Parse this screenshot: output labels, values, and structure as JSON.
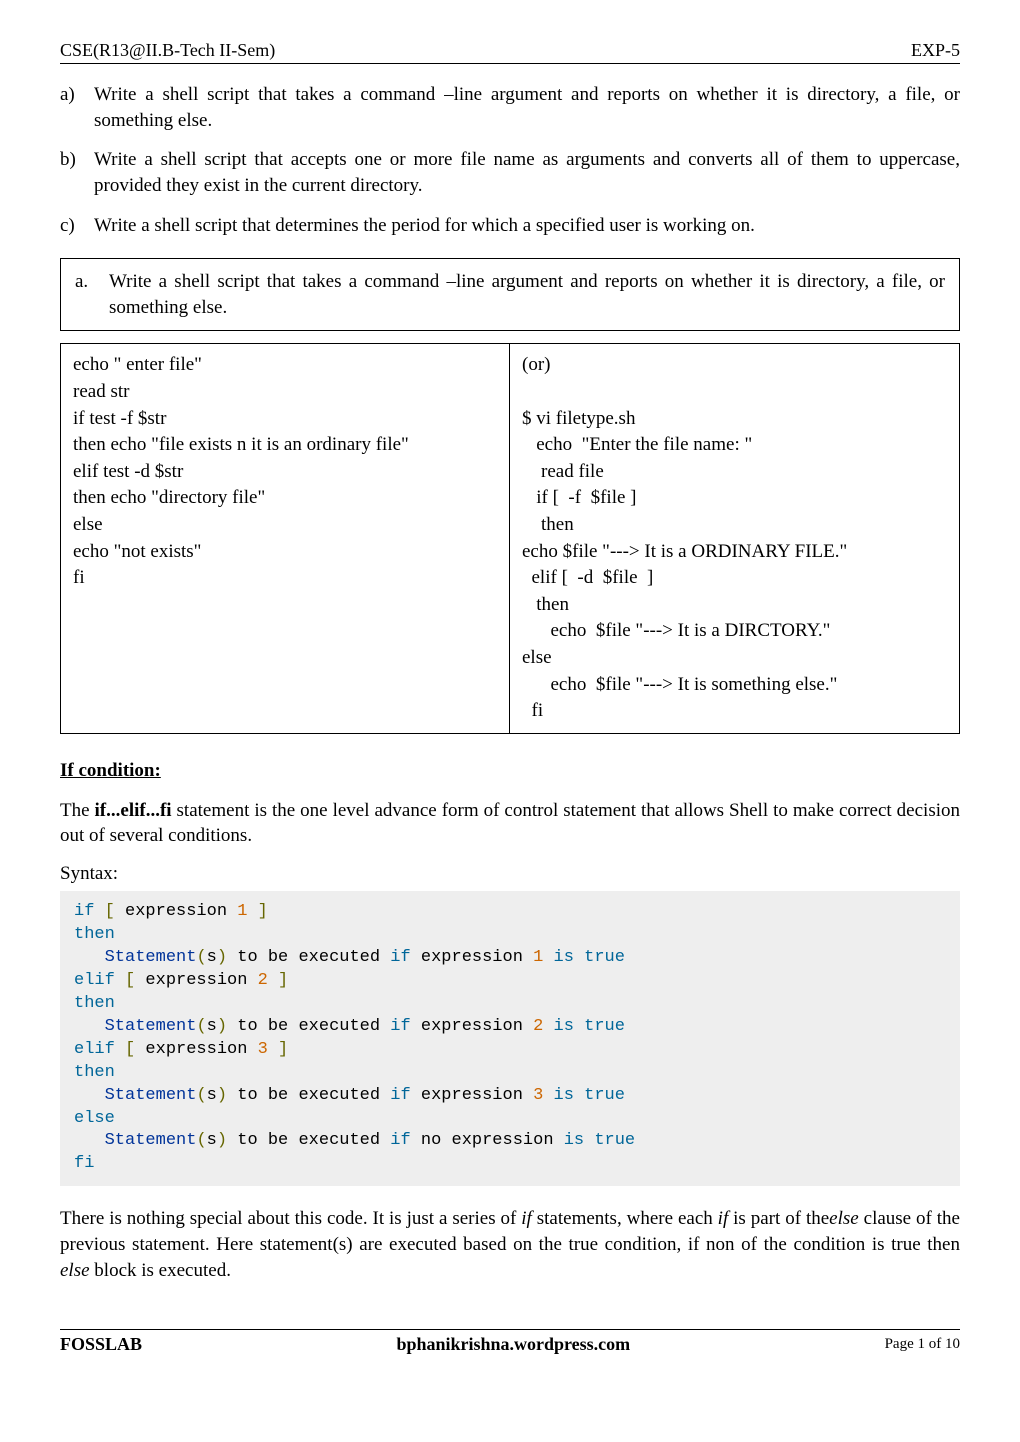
{
  "header": {
    "left": "CSE(R13@II.B-Tech II-Sem)",
    "right": "EXP-5"
  },
  "questions": [
    {
      "letter": "a)",
      "text": "Write a shell script that takes a command –line argument and reports on whether it is directory, a file, or something else."
    },
    {
      "letter": "b)",
      "text": "Write a shell script that accepts one or more file name as arguments and converts all of them to uppercase, provided   they exist in the current directory."
    },
    {
      "letter": "c)",
      "text": "Write a shell script that determines the period for which a specified user is working on."
    }
  ],
  "box_question": {
    "letter": "a.",
    "text": "Write a shell script that takes a command –line argument and reports on whether it is directory, a file, or something else."
  },
  "code_left": "echo \" enter file\"\nread str\nif test -f $str\nthen echo \"file exists n it is an ordinary file\"\nelif test -d $str\nthen echo \"directory file\"\nelse\necho \"not exists\"\nfi",
  "code_right": "(or)\n\n$ vi filetype.sh\n   echo  \"Enter the file name: \"\n    read file\n   if [  -f  $file ]\n    then\necho $file \"---> It is a ORDINARY FILE.\"\n  elif [  -d  $file  ]\n   then\n      echo  $file \"---> It is a DIRCTORY.\"\nelse\n      echo  $file \"---> It is something else.\"\n  fi",
  "section_title": "If condition:",
  "para1_pre": "The ",
  "para1_bold": "if...elif...fi",
  "para1_post": " statement is the one level advance form of control statement that allows Shell to make correct decision out of several conditions.",
  "syntax_label": "Syntax:",
  "syntax_lines": {
    "l1_if": "if",
    "l1_lb": " [",
    "l1_expr": " expression ",
    "l1_num": "1",
    "l1_rb": " ]",
    "l2_then": "then",
    "l3_stmt": "   Statement",
    "l3_lp": "(",
    "l3_s": "s",
    "l3_rp": ")",
    "l3_mid": " to be executed ",
    "l3_if": "if",
    "l3_expr": " expression ",
    "l3_num": "1",
    "l3_is": " is",
    "l3_true": " true",
    "l4_elif": "elif",
    "l4_lb": " [",
    "l4_expr": " expression ",
    "l4_num": "2",
    "l4_rb": " ]",
    "l5_then": "then",
    "l6_stmt": "   Statement",
    "l6_lp": "(",
    "l6_s": "s",
    "l6_rp": ")",
    "l6_mid": " to be executed ",
    "l6_if": "if",
    "l6_expr": " expression ",
    "l6_num": "2",
    "l6_is": " is",
    "l6_true": " true",
    "l7_elif": "elif",
    "l7_lb": " [",
    "l7_expr": " expression ",
    "l7_num": "3",
    "l7_rb": " ]",
    "l8_then": "then",
    "l9_stmt": "   Statement",
    "l9_lp": "(",
    "l9_s": "s",
    "l9_rp": ")",
    "l9_mid": " to be executed ",
    "l9_if": "if",
    "l9_expr": " expression ",
    "l9_num": "3",
    "l9_is": " is",
    "l9_true": " true",
    "l10_else": "else",
    "l11_stmt": "   Statement",
    "l11_lp": "(",
    "l11_s": "s",
    "l11_rp": ")",
    "l11_mid": " to be executed ",
    "l11_if": "if",
    "l11_no": " no",
    "l11_expr": " expression ",
    "l11_is": "is",
    "l11_true": " true",
    "l12_fi": "fi"
  },
  "para2": {
    "t1": "There is nothing special about this code. It is just a series of ",
    "i1": "if",
    "t2": " statements, where each ",
    "i2": "if",
    "t3": " is part of the",
    "i3": "else",
    "t4": " clause of the previous statement. Here statement(s) are executed based on the true condition, if non of the condition is true then ",
    "i4": "else",
    "t5": " block is executed."
  },
  "footer": {
    "left": "FOSSLAB",
    "center": "bphanikrishna.wordpress.com",
    "right": "Page 1 of 10"
  }
}
